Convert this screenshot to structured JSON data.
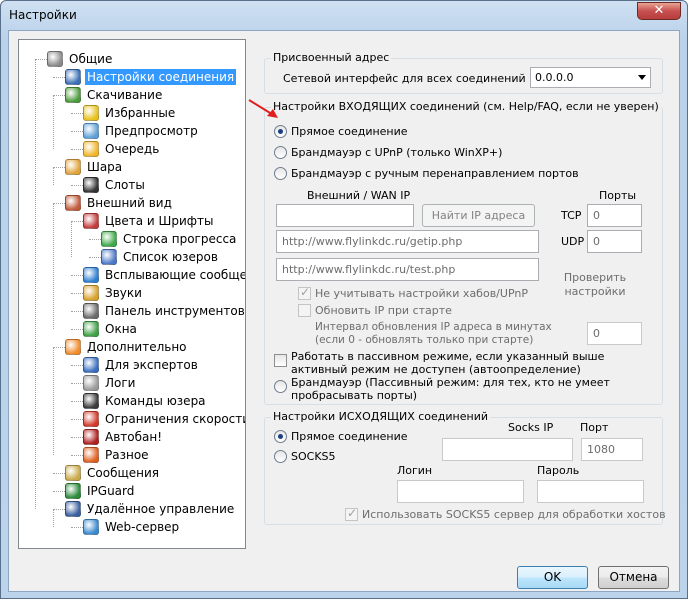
{
  "window": {
    "title": "Настройки",
    "close_glyph": "✕"
  },
  "tree": {
    "items": [
      {
        "label": "Общие",
        "icon": "general-icon",
        "color": "#8a8a8a"
      },
      {
        "label": "Настройки соединения",
        "icon": "network-icon",
        "color": "#3b6fb6"
      },
      {
        "label": "Скачивание",
        "icon": "download-icon",
        "color": "#4c9a3b"
      },
      {
        "label": "Избранные",
        "icon": "star-icon",
        "color": "#e8c21b"
      },
      {
        "label": "Предпросмотр",
        "icon": "preview-icon",
        "color": "#5da0d8"
      },
      {
        "label": "Очередь",
        "icon": "queue-icon",
        "color": "#f0b528"
      },
      {
        "label": "Шара",
        "icon": "share-icon",
        "color": "#e0a23a"
      },
      {
        "label": "Слоты",
        "icon": "slots-icon",
        "color": "#333333"
      },
      {
        "label": "Внешний вид",
        "icon": "appearance-icon",
        "color": "#c05a3a"
      },
      {
        "label": "Цвета и Шрифты",
        "icon": "colors-icon",
        "color": "#c33b3b"
      },
      {
        "label": "Строка прогресса",
        "icon": "progress-icon",
        "color": "#3fa84a"
      },
      {
        "label": "Список юзеров",
        "icon": "users-icon",
        "color": "#4a78c8"
      },
      {
        "label": "Всплывающие сообщения",
        "icon": "popup-icon",
        "color": "#2f7fd0"
      },
      {
        "label": "Звуки",
        "icon": "sound-icon",
        "color": "#d9a12b"
      },
      {
        "label": "Панель инструментов",
        "icon": "toolbar-icon",
        "color": "#6a6a6a"
      },
      {
        "label": "Окна",
        "icon": "windows-icon",
        "color": "#3da043"
      },
      {
        "label": "Дополнительно",
        "icon": "advanced-icon",
        "color": "#f08a2a"
      },
      {
        "label": "Для экспертов",
        "icon": "expert-icon",
        "color": "#3a6fc0"
      },
      {
        "label": "Логи",
        "icon": "logs-icon",
        "color": "#9a9a9a"
      },
      {
        "label": "Команды юзера",
        "icon": "commands-icon",
        "color": "#3a3a3a"
      },
      {
        "label": "Ограничения скорости",
        "icon": "speed-limit-icon",
        "color": "#d23a2a"
      },
      {
        "label": "Автобан!",
        "icon": "autoban-icon",
        "color": "#b02020"
      },
      {
        "label": "Разное",
        "icon": "misc-icon",
        "color": "#e06020"
      },
      {
        "label": "Сообщения",
        "icon": "messages-icon",
        "color": "#c9a94a"
      },
      {
        "label": "IPGuard",
        "icon": "ipguard-icon",
        "color": "#2a8a3a"
      },
      {
        "label": "Удалённое управление",
        "icon": "remote-icon",
        "color": "#3a5fa0"
      },
      {
        "label": "Web-сервер",
        "icon": "webserver-icon",
        "color": "#3a8ad0"
      }
    ]
  },
  "assigned": {
    "title": "Присвоенный адрес",
    "iface_label": "Сетевой интерфейс для всех соединений",
    "iface_value": "0.0.0.0"
  },
  "incoming": {
    "title": "Настройки ВХОДЯЩИХ соединений (см. Help/FAQ, если не уверен)",
    "direct": "Прямое соединение",
    "upnp": "Брандмауэр с UPnP (только WinXP+)",
    "manual": "Брандмауэр с ручным перенаправлением портов",
    "wan_label": "Внешний / WAN IP",
    "ports_label": "Порты",
    "find_ip": "Найти IP адреса",
    "tcp": "TCP",
    "udp": "UDP",
    "tcp_value": "0",
    "udp_value": "0",
    "url1": "http://www.flylinkdc.ru/getip.php",
    "url2": "http://www.flylinkdc.ru/test.php",
    "check_settings": "Проверить настройки",
    "ignore_upnp": "Не учитывать настройки хабов/UPnP",
    "update_ip": "Обновить IP при старте",
    "interval_label": "Интервал обновления IP адреса в минутах (если 0 - обновлять только при старте)",
    "interval_value": "0",
    "passive": "Работать в пассивном режиме, если указанный выше активный режим не доступен (автоопределение)",
    "firewall_passive": "Брандмауэр (Пассивный режим: для тех, кто не умеет пробрасывать порты)"
  },
  "outgoing": {
    "title": "Настройки ИСХОДЯЩИХ соединений",
    "direct": "Прямое соединение",
    "socks5": "SOCKS5",
    "socks_ip": "Socks IP",
    "port": "Порт",
    "port_value": "1080",
    "login": "Логин",
    "password": "Пароль",
    "use_socks": "Использовать SOCKS5 сервер для обработки хостов"
  },
  "buttons": {
    "ok": "OK",
    "cancel": "Отмена"
  },
  "colors": {
    "selection": "#3399ff",
    "annotation_arrow": "#e02020"
  }
}
